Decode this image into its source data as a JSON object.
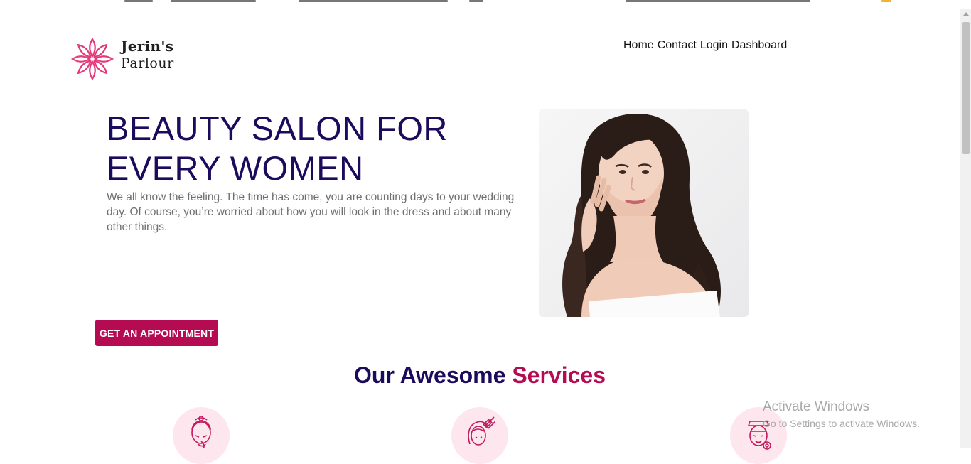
{
  "brand": {
    "name_line1": "Jerin's",
    "name_line2": "Parlour",
    "accent_color": "#e5397a",
    "icon": "lotus-flower-icon"
  },
  "nav": {
    "items": [
      "Home",
      "Contact",
      "Login",
      "Dashboard"
    ]
  },
  "hero": {
    "title_line1": "BEAUTY SALON FOR",
    "title_line2": "EVERY WOMEN",
    "description": "We all know the feeling. The time has come, you are counting days to your wedding day. Of course, you’re worried about how you will look in the dress and about many other things.",
    "image": "woman-portrait-image",
    "cta_label": "GET AN APPOINTMENT",
    "title_color": "#1c0a5c",
    "cta_color": "#b50b52"
  },
  "services": {
    "title_part1": "Our Awesome",
    "title_part2": "Services",
    "icons": [
      "face-care-icon",
      "hair-coloring-icon",
      "skin-treatment-icon"
    ]
  },
  "system_watermark": {
    "line1": "Activate Windows",
    "line2": "Go to Settings to activate Windows."
  }
}
